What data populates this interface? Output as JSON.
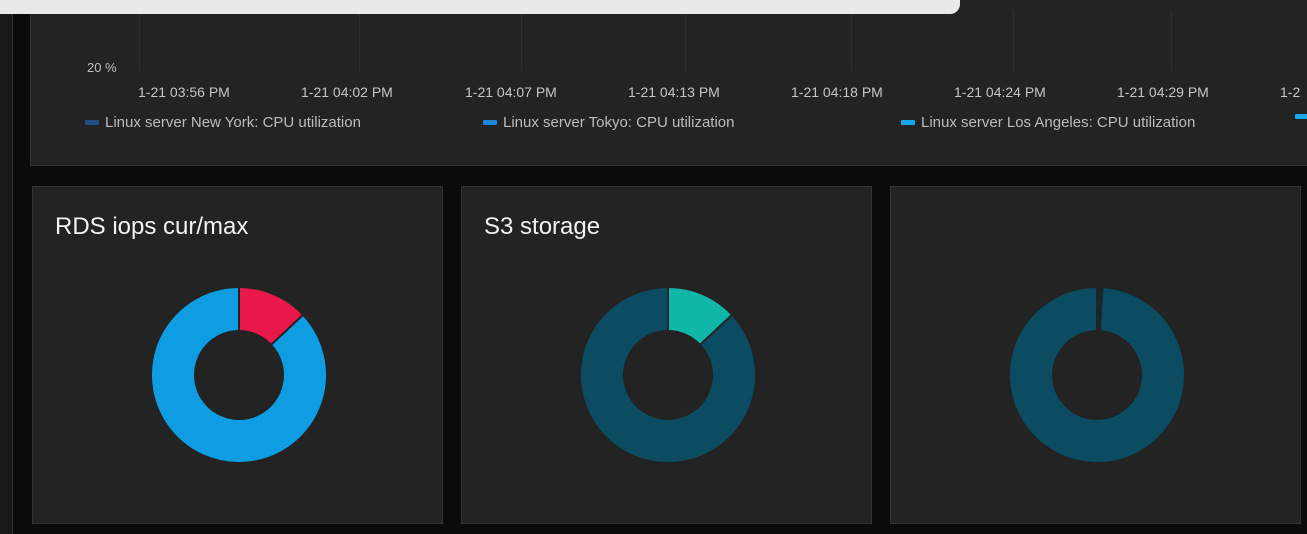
{
  "graph": {
    "y_tick": "20 %",
    "x_ticks": [
      "1-21 03:56 PM",
      "1-21 04:02 PM",
      "1-21 04:07 PM",
      "1-21 04:13 PM",
      "1-21 04:18 PM",
      "1-21 04:24 PM",
      "1-21 04:29 PM",
      "1-2"
    ],
    "legend": [
      {
        "label": "Linux server New York: CPU utilization",
        "color": "#1f4f86"
      },
      {
        "label": "Linux server Tokyo: CPU utilization",
        "color": "#1e86d8"
      },
      {
        "label": "Linux server Los Angeles: CPU utilization",
        "color": "#1aa6ee"
      }
    ]
  },
  "widgets": [
    {
      "title": "RDS iops cur/max",
      "chart_data": {
        "type": "pie",
        "slices": [
          {
            "value": 13,
            "color": "#e8184a"
          },
          {
            "value": 87,
            "color": "#0e9ce2"
          }
        ]
      }
    },
    {
      "title": "S3 storage",
      "chart_data": {
        "type": "pie",
        "slices": [
          {
            "value": 13,
            "color": "#10b6a7"
          },
          {
            "value": 87,
            "color": "#0b4c63"
          }
        ]
      }
    },
    {
      "title": "",
      "chart_data": {
        "type": "pie",
        "slices": [
          {
            "value": 1,
            "color": "#0f2a34"
          },
          {
            "value": 99,
            "color": "#0b4c63"
          }
        ]
      }
    }
  ]
}
